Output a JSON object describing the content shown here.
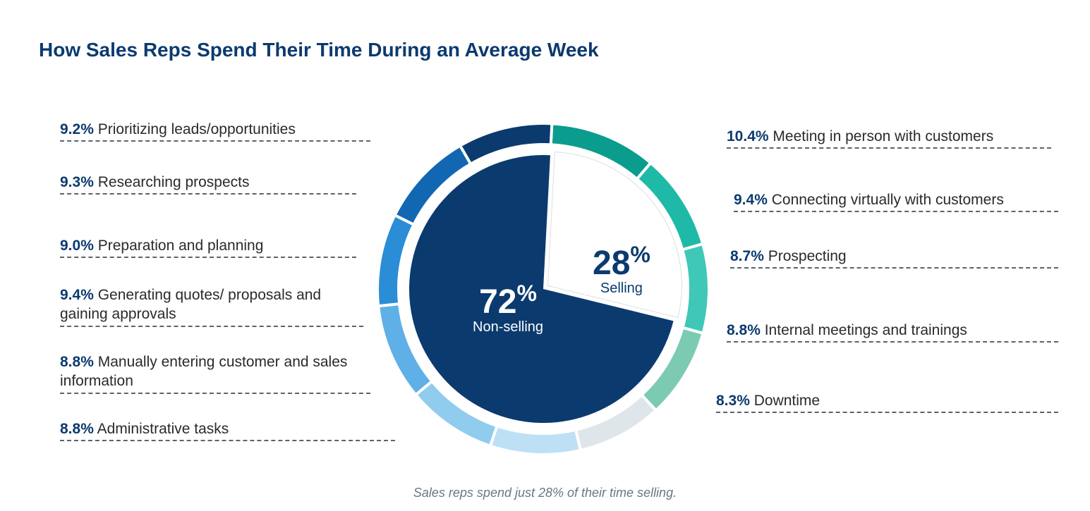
{
  "title": "How Sales Reps Spend Their Time During an Average Week",
  "caption": "Sales reps spend just 28% of their time selling.",
  "pie": {
    "non_selling_pct": "72",
    "non_selling_label": "Non-selling",
    "selling_pct": "28",
    "selling_label": "Selling"
  },
  "left_items": [
    {
      "pct": "9.2%",
      "label": "Prioritizing leads/opportunities"
    },
    {
      "pct": "9.3%",
      "label": "Researching prospects"
    },
    {
      "pct": "9.0%",
      "label": "Preparation and planning"
    },
    {
      "pct": "9.4%",
      "label": "Generating quotes/ proposals and gaining approvals"
    },
    {
      "pct": "8.8%",
      "label": "Manually entering customer and sales information"
    },
    {
      "pct": "8.8%",
      "label": "Administrative tasks"
    }
  ],
  "right_items": [
    {
      "pct": "10.4%",
      "label": "Meeting in person with customers"
    },
    {
      "pct": "9.4%",
      "label": "Connecting virtually with customers"
    },
    {
      "pct": "8.7%",
      "label": "Prospecting"
    },
    {
      "pct": "8.8%",
      "label": "Internal meetings and trainings"
    },
    {
      "pct": "8.3%",
      "label": "Downtime"
    }
  ],
  "chart_data": {
    "type": "pie",
    "title": "How Sales Reps Spend Their Time During an Average Week",
    "inner_pie": [
      {
        "name": "Non-selling",
        "value": 72
      },
      {
        "name": "Selling",
        "value": 28
      }
    ],
    "outer_ring_segments": [
      {
        "name": "Prioritizing leads/opportunities",
        "value": 9.2,
        "group": "Non-selling",
        "color": "#0b3a6f"
      },
      {
        "name": "Researching prospects",
        "value": 9.3,
        "group": "Non-selling",
        "color": "#1267b3"
      },
      {
        "name": "Preparation and planning",
        "value": 9.0,
        "group": "Non-selling",
        "color": "#2a8dd6"
      },
      {
        "name": "Generating quotes/proposals and gaining approvals",
        "value": 9.4,
        "group": "Non-selling",
        "color": "#5fb0e6"
      },
      {
        "name": "Manually entering customer and sales information",
        "value": 8.8,
        "group": "Non-selling",
        "color": "#8fccee"
      },
      {
        "name": "Administrative tasks",
        "value": 8.8,
        "group": "Non-selling",
        "color": "#bee0f5"
      },
      {
        "name": "Downtime",
        "value": 8.3,
        "group": "Non-selling",
        "color": "#dfe6ea"
      },
      {
        "name": "Internal meetings and trainings",
        "value": 8.8,
        "group": "Non-selling",
        "color": "#7dcab3"
      },
      {
        "name": "Prospecting",
        "value": 8.7,
        "group": "Selling",
        "color": "#3fc7b7"
      },
      {
        "name": "Connecting virtually with customers",
        "value": 9.4,
        "group": "Selling",
        "color": "#1fb9a8"
      },
      {
        "name": "Meeting in person with customers",
        "value": 10.4,
        "group": "Selling",
        "color": "#0a9c8d"
      }
    ]
  }
}
